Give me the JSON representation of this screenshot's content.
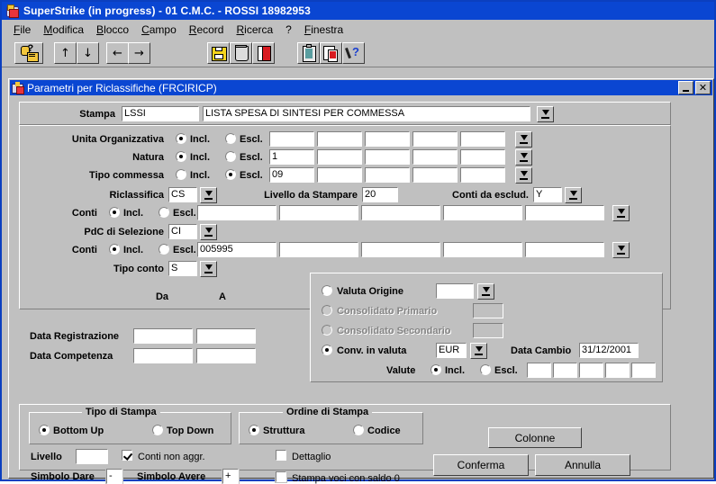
{
  "window": {
    "title": "SuperStrike (in progress) - 01 C.M.C. - ROSSI 18982953",
    "icon": "app-icon"
  },
  "menubar": {
    "items": [
      {
        "label": "File"
      },
      {
        "label": "Modifica"
      },
      {
        "label": "Blocco"
      },
      {
        "label": "Campo"
      },
      {
        "label": "Record"
      },
      {
        "label": "Ricerca"
      },
      {
        "label": "?"
      },
      {
        "label": "Finestra"
      }
    ]
  },
  "toolbar": {
    "buttons": [
      {
        "name": "query-icon",
        "glyph": ""
      },
      {
        "name": "arrow-up-icon",
        "glyph": "↑"
      },
      {
        "name": "arrow-down-icon",
        "glyph": "↓"
      },
      {
        "name": "arrow-left-icon",
        "glyph": "←"
      },
      {
        "name": "arrow-right-icon",
        "glyph": "→"
      },
      {
        "name": "save-icon",
        "glyph": ""
      },
      {
        "name": "delete-icon",
        "glyph": ""
      },
      {
        "name": "exit-icon",
        "glyph": ""
      },
      {
        "name": "clipboard-icon",
        "glyph": ""
      },
      {
        "name": "copy-icon",
        "glyph": ""
      },
      {
        "name": "help-icon",
        "glyph": ""
      }
    ]
  },
  "child_window": {
    "title": "Parametri per Riclassifiche (FRCIRICP)",
    "minimize_label": "",
    "close_label": "✕"
  },
  "form": {
    "stampa": {
      "label": "Stampa",
      "code": "LSSI",
      "description": "LISTA SPESA DI SINTESI PER COMMESSA"
    },
    "rows": [
      {
        "label": "Unita Organizzativa",
        "incl_label": "Incl.",
        "escl_label": "Escl.",
        "mode": "incl",
        "values": [
          "",
          "",
          "",
          "",
          ""
        ]
      },
      {
        "label": "Natura",
        "incl_label": "Incl.",
        "escl_label": "Escl.",
        "mode": "incl",
        "values": [
          "1",
          "",
          "",
          "",
          ""
        ]
      },
      {
        "label": "Tipo commessa",
        "incl_label": "Incl.",
        "escl_label": "Escl.",
        "mode": "escl",
        "values": [
          "09",
          "",
          "",
          "",
          ""
        ]
      }
    ],
    "riclassifica": {
      "label": "Riclassifica",
      "value": "CS",
      "livello_label": "Livello da Stampare",
      "livello_value": "20",
      "conti_escl_label": "Conti da esclud.",
      "conti_escl_value": "Y"
    },
    "conti1": {
      "label": "Conti",
      "incl_label": "Incl.",
      "escl_label": "Escl.",
      "mode": "incl",
      "values": [
        "",
        "",
        "",
        "",
        ""
      ]
    },
    "pdc": {
      "label": "PdC di Selezione",
      "value": "CI"
    },
    "conti2": {
      "label": "Conti",
      "incl_label": "Incl.",
      "escl_label": "Escl.",
      "mode": "incl",
      "values": [
        "005995",
        "",
        "",
        "",
        ""
      ]
    },
    "tipo_conto": {
      "label": "Tipo conto",
      "value": "S"
    },
    "dates": {
      "da_label": "Da",
      "a_label": "A",
      "rows": [
        {
          "label": "Data Registrazione",
          "da": "",
          "a": ""
        },
        {
          "label": "Data Competenza",
          "da": "",
          "a": ""
        }
      ]
    },
    "valuta": {
      "origine_label": "Valuta Origine",
      "origine_value": "",
      "origine_selected": false,
      "cons_primario_label": "Consolidato Primario",
      "cons_primario_value": "",
      "cons_primario_selected": false,
      "cons_secondario_label": "Consolidato Secondario",
      "cons_secondario_value": "",
      "cons_secondario_selected": false,
      "conv_label": "Conv. in valuta",
      "conv_value": "EUR",
      "conv_selected": true,
      "data_cambio_label": "Data Cambio",
      "data_cambio_value": "31/12/2001",
      "valute_label": "Valute",
      "valute_incl_label": "Incl.",
      "valute_escl_label": "Escl.",
      "valute_mode": "incl",
      "valute_values": [
        "",
        "",
        "",
        "",
        ""
      ]
    },
    "tipo_stampa": {
      "title": "Tipo di Stampa",
      "options": [
        {
          "label": "Bottom Up",
          "selected": true
        },
        {
          "label": "Top Down",
          "selected": false
        }
      ]
    },
    "ordine_stampa": {
      "title": "Ordine di Stampa",
      "options": [
        {
          "label": "Struttura",
          "selected": true
        },
        {
          "label": "Codice",
          "selected": false
        }
      ]
    },
    "livello": {
      "label": "Livello",
      "value": ""
    },
    "conti_non_aggr": {
      "label": "Conti non aggr.",
      "checked": true
    },
    "simbolo_dare": {
      "label": "Simbolo Dare",
      "value": "-"
    },
    "simbolo_avere": {
      "label": "Simbolo Avere",
      "value": "+"
    },
    "dettaglio": {
      "label": "Dettaglio",
      "checked": false
    },
    "stampa_saldo0": {
      "label": "Stampa voci con saldo 0",
      "checked": false
    },
    "buttons": {
      "colonne": "Colonne",
      "conferma": "Conferma",
      "annulla": "Annulla"
    }
  },
  "colors": {
    "titlebar": "#0a46d2",
    "face": "#c0c0c0",
    "field": "#ffffff",
    "disabled_text": "#848484"
  }
}
